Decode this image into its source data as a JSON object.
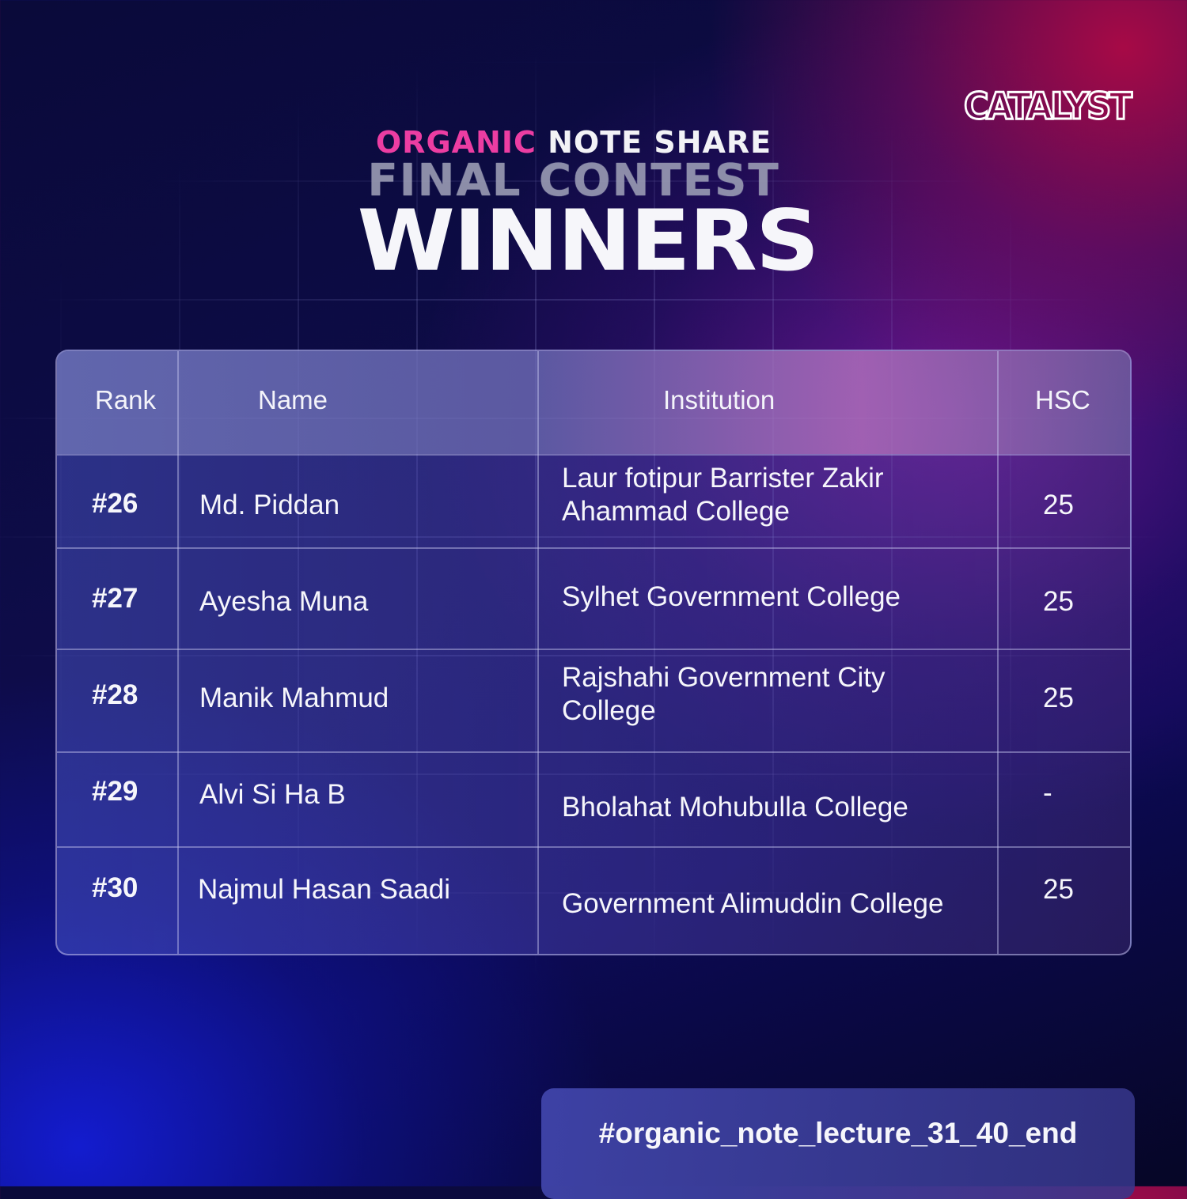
{
  "brand": {
    "logo_text": "CATALYST",
    "colors": {
      "accent_pink": "#ec3da2",
      "text": "#f6f6fb"
    }
  },
  "title": {
    "part1_highlight": "ORGANIC",
    "part1_rest": "NOTE SHARE",
    "line2": "FINAL CONTEST",
    "line3": "WINNERS"
  },
  "table": {
    "headers": {
      "rank": "Rank",
      "name": "Name",
      "institution": "Institution",
      "hsc": "HSC"
    },
    "rows": [
      {
        "rank": "#26",
        "name": "Md. Piddan",
        "institution_line1": "Laur fotipur Barrister Zakir",
        "institution_line2": "Ahammad College",
        "hsc": "25"
      },
      {
        "rank": "#27",
        "name": "Ayesha Muna",
        "institution_line1": "Sylhet Government College",
        "institution_line2": "",
        "hsc": "25"
      },
      {
        "rank": "#28",
        "name": "Manik Mahmud",
        "institution_line1": "Rajshahi Government City",
        "institution_line2": "College",
        "hsc": "25"
      },
      {
        "rank": "#29",
        "name": "Alvi Si Ha B",
        "institution_line1": "Bholahat Mohubulla College",
        "institution_line2": "",
        "hsc": "-"
      },
      {
        "rank": "#30",
        "name": "Najmul Hasan Saadi",
        "institution_line1": "Government Alimuddin College",
        "institution_line2": "",
        "hsc": "25"
      }
    ]
  },
  "hashtag": "#organic_note_lecture_31_40_end"
}
